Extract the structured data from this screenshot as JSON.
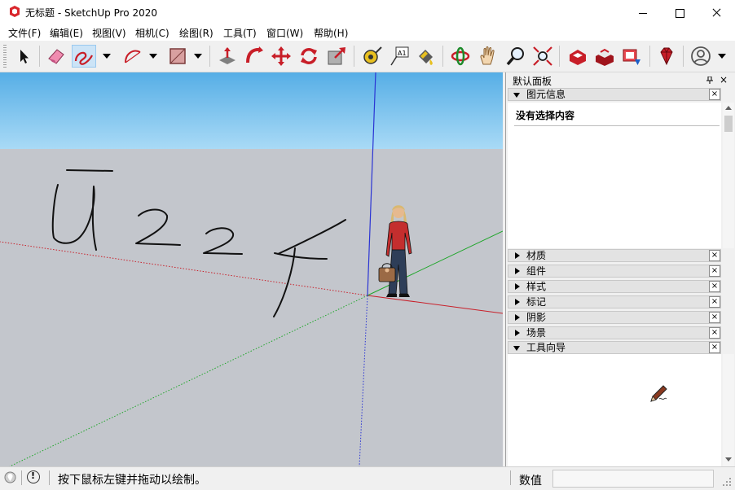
{
  "window": {
    "title": "无标题 - SketchUp Pro 2020"
  },
  "menu": [
    "文件(F)",
    "编辑(E)",
    "视图(V)",
    "相机(C)",
    "绘图(R)",
    "工具(T)",
    "窗口(W)",
    "帮助(H)"
  ],
  "toolbar": {
    "tools": [
      "select-icon",
      "eraser-icon",
      "freehand-icon",
      "arc-icon",
      "rectangle-icon",
      "push-pull-icon",
      "follow-me-icon",
      "move-icon",
      "rotate-icon",
      "scale-icon",
      "tape-measure-icon",
      "text-icon",
      "paint-bucket-icon",
      "orbit-icon",
      "pan-icon",
      "zoom-icon",
      "zoom-extents-icon",
      "warehouse-icon",
      "extension-warehouse-icon",
      "layout-icon",
      "extension-manager-icon",
      "account-icon"
    ],
    "active_tool": "freehand-icon"
  },
  "viewport": {
    "sky_color": "#7fc4ee",
    "ground_color": "#c3c6cc",
    "axis_colors": {
      "red": "#c8202a",
      "green": "#1fa62a",
      "blue": "#2a34d4"
    }
  },
  "panel": {
    "title": "默认面板",
    "entity_info": {
      "label": "图元信息",
      "content": "没有选择内容"
    },
    "trays": [
      "材质",
      "组件",
      "样式",
      "标记",
      "阴影",
      "场景"
    ],
    "instructor": {
      "label": "工具向导"
    },
    "close_symbol": "×"
  },
  "status": {
    "message": "按下鼠标左键并拖动以绘制。",
    "measurement_label": "数值",
    "measurement_value": ""
  }
}
